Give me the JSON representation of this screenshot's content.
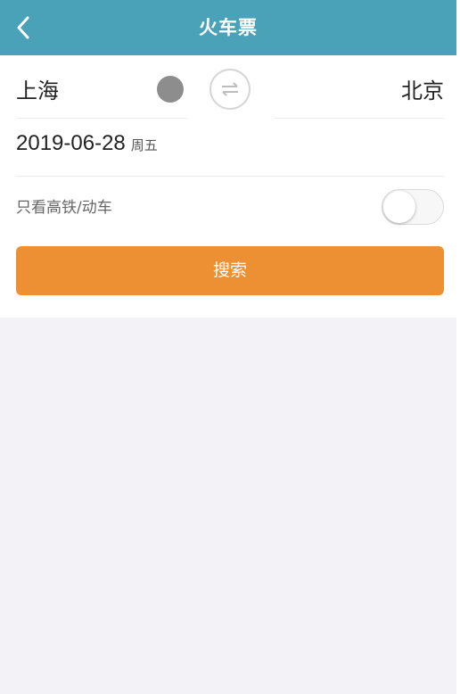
{
  "header": {
    "title": "火车票",
    "back_icon": "chevron-left-icon",
    "background_color": "#4aa2b8"
  },
  "route": {
    "from_city": "上海",
    "to_city": "北京",
    "swap_icon": "swap-arrows-icon"
  },
  "date": {
    "value": "2019-06-28",
    "weekday": "周五"
  },
  "filter": {
    "label": "只看高铁/动车",
    "enabled": false
  },
  "search": {
    "label": "搜索",
    "color": "#ec9033"
  }
}
